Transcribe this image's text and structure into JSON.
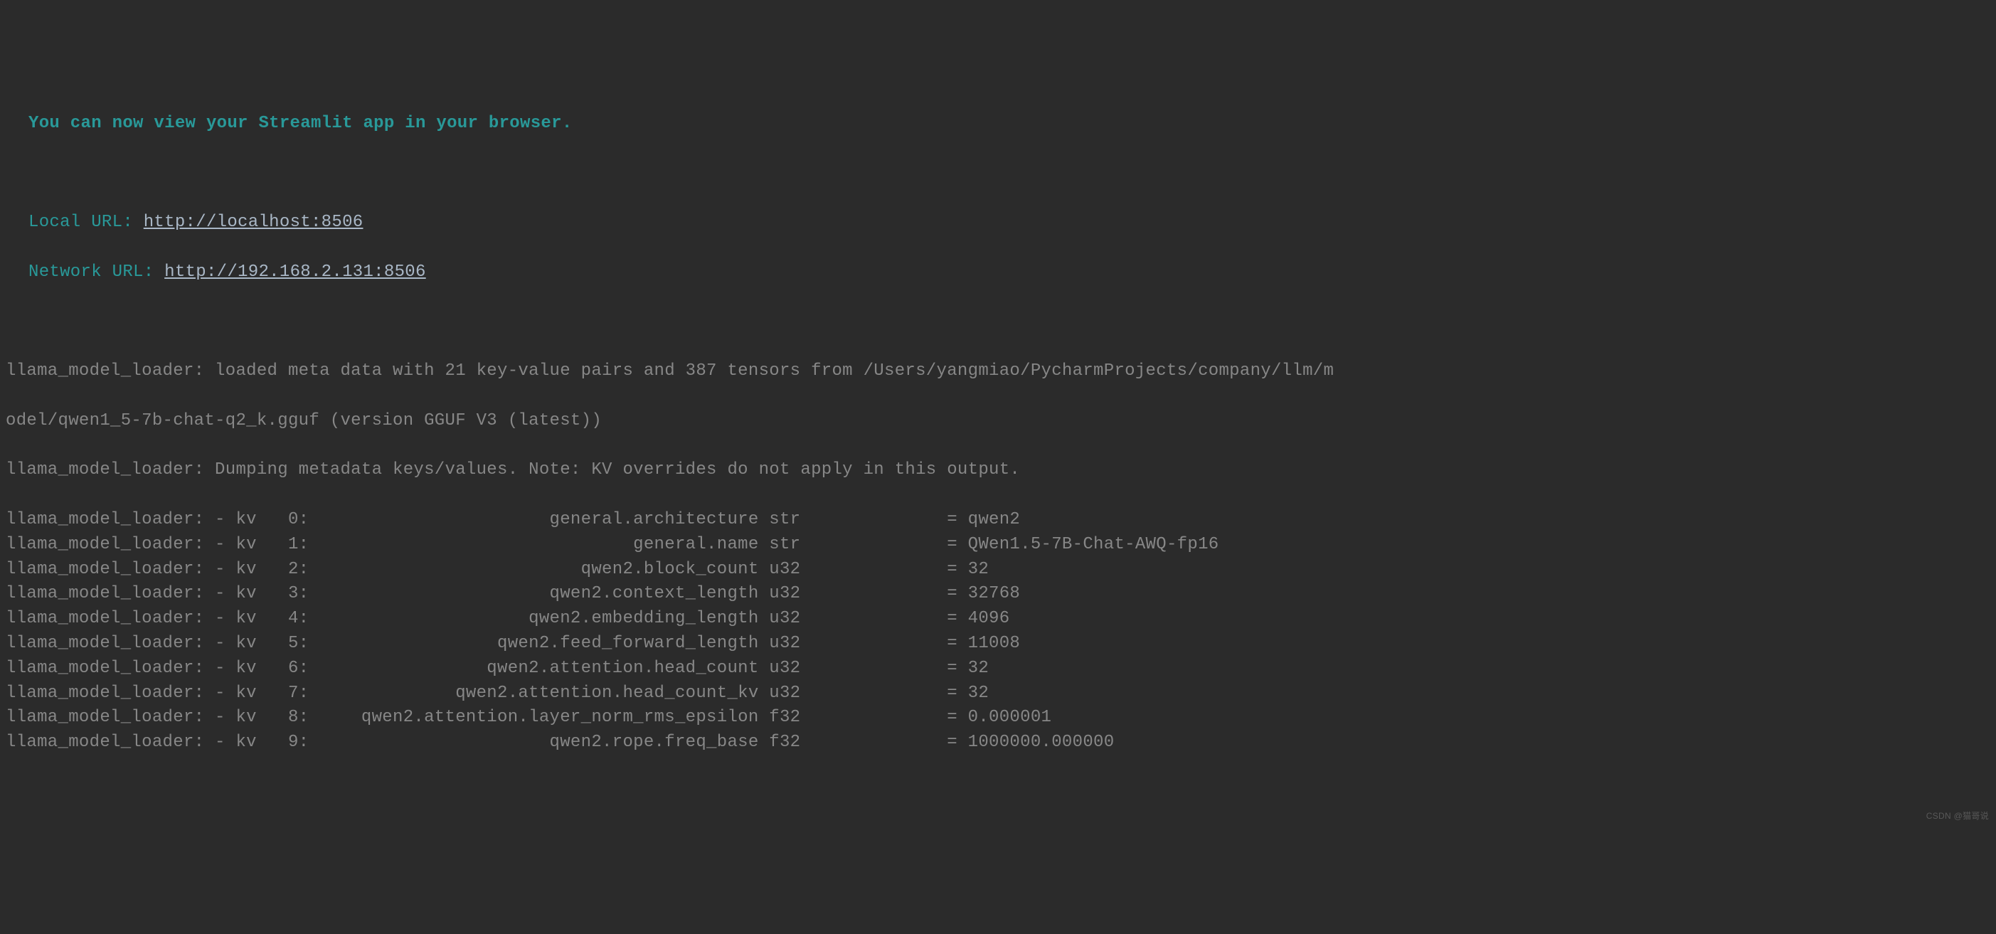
{
  "header": {
    "banner": "You can now view your Streamlit app in your browser.",
    "local_label": "Local URL: ",
    "local_url": "http://localhost:8506",
    "network_label": "Network URL: ",
    "network_url": "http://192.168.2.131:8506"
  },
  "log": {
    "meta_line": "llama_model_loader: loaded meta data with 21 key-value pairs and 387 tensors from /Users/yangmiao/PycharmProjects/company/llm/m",
    "meta_line2": "odel/qwen1_5-7b-chat-q2_k.gguf (version GGUF V3 (latest))",
    "dump_line": "llama_model_loader: Dumping metadata keys/values. Note: KV overrides do not apply in this output.",
    "kv_prefix": "llama_model_loader: - kv ",
    "entries": [
      {
        "idx": "  0:",
        "key": "                       general.architecture",
        "type": "str    ",
        "val": "          = qwen2"
      },
      {
        "idx": "  1:",
        "key": "                               general.name",
        "type": "str    ",
        "val": "          = QWen1.5-7B-Chat-AWQ-fp16"
      },
      {
        "idx": "  2:",
        "key": "                          qwen2.block_count",
        "type": "u32    ",
        "val": "          = 32"
      },
      {
        "idx": "  3:",
        "key": "                       qwen2.context_length",
        "type": "u32    ",
        "val": "          = 32768"
      },
      {
        "idx": "  4:",
        "key": "                     qwen2.embedding_length",
        "type": "u32    ",
        "val": "          = 4096"
      },
      {
        "idx": "  5:",
        "key": "                  qwen2.feed_forward_length",
        "type": "u32    ",
        "val": "          = 11008"
      },
      {
        "idx": "  6:",
        "key": "                 qwen2.attention.head_count",
        "type": "u32    ",
        "val": "          = 32"
      },
      {
        "idx": "  7:",
        "key": "              qwen2.attention.head_count_kv",
        "type": "u32    ",
        "val": "          = 32"
      },
      {
        "idx": "  8:",
        "key": "     qwen2.attention.layer_norm_rms_epsilon",
        "type": "f32    ",
        "val": "          = 0.000001"
      },
      {
        "idx": "  9:",
        "key": "                       qwen2.rope.freq_base",
        "type": "f32    ",
        "val": "          = 1000000.000000"
      }
    ]
  },
  "watermark": "CSDN @猫哥说"
}
